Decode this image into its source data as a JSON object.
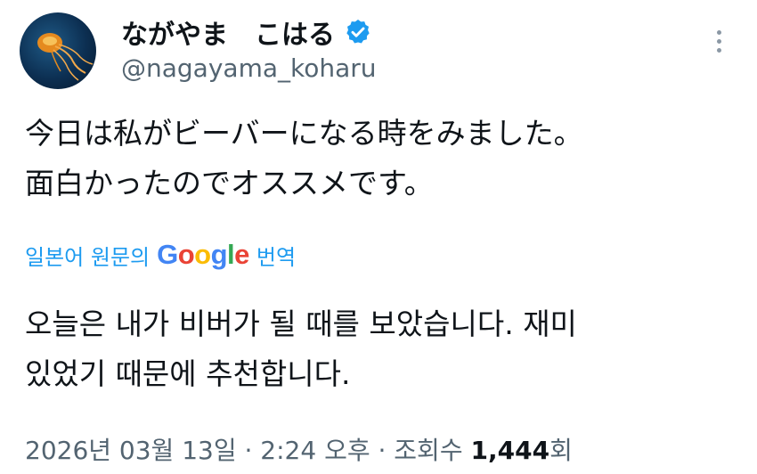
{
  "author": {
    "display_name": "ながやま　こはる",
    "handle": "@nagayama_koharu",
    "verified_icon": "verified-badge-icon",
    "avatar_icon": "jellyfish-avatar"
  },
  "tweet": {
    "line1": "今日は私がビーバーになる時をみました。",
    "line2": "面白かったのでオススメです。"
  },
  "translation": {
    "prefix": "일본어 원문의",
    "google": [
      "G",
      "o",
      "o",
      "g",
      "l",
      "e"
    ],
    "suffix": "번역",
    "line1": "오늘은 내가 비버가 될 때를 보았습니다. 재미",
    "line2": "있었기 때문에 추천합니다."
  },
  "meta": {
    "datetime": "2026년 03월 13일 · 2:24 오후 · 조회수 ",
    "views": "1,444",
    "views_suffix": "회"
  },
  "colors": {
    "link": "#1d9bf0",
    "muted": "#536471",
    "verified": "#1d9bf0"
  }
}
